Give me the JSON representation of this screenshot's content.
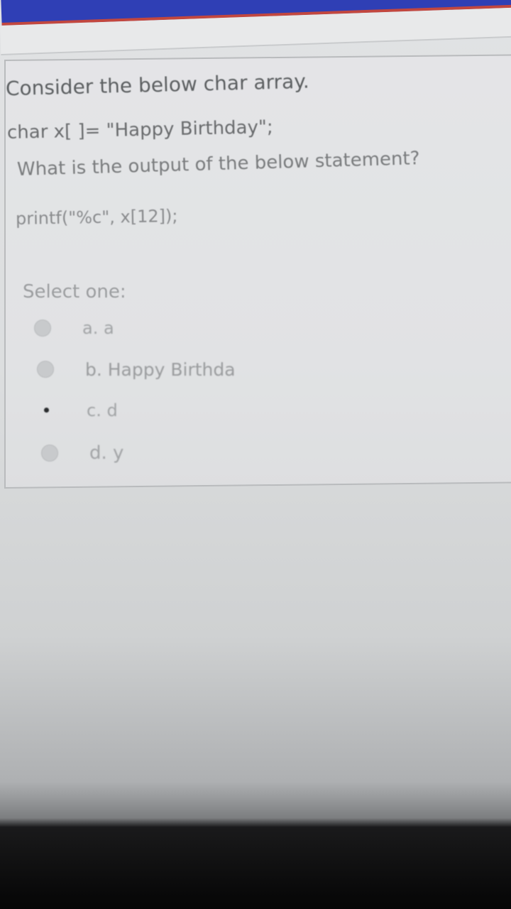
{
  "question": {
    "line1": "Consider the below char array.",
    "line2": "char x[ ]= \"Happy Birthday\";",
    "line3": "What is the output of the below statement?",
    "line4": "printf(\"%c\", x[12]);"
  },
  "select_label": "Select one:",
  "options": [
    {
      "label": "a. a",
      "selected": false
    },
    {
      "label": "b. Happy Birthda",
      "selected": false
    },
    {
      "label": "c. d",
      "selected": true
    },
    {
      "label": "d. y",
      "selected": false
    }
  ],
  "colors": {
    "top_bar": "#2f3fb5",
    "top_bar_accent": "#c2473f",
    "text": "#6f7173"
  }
}
